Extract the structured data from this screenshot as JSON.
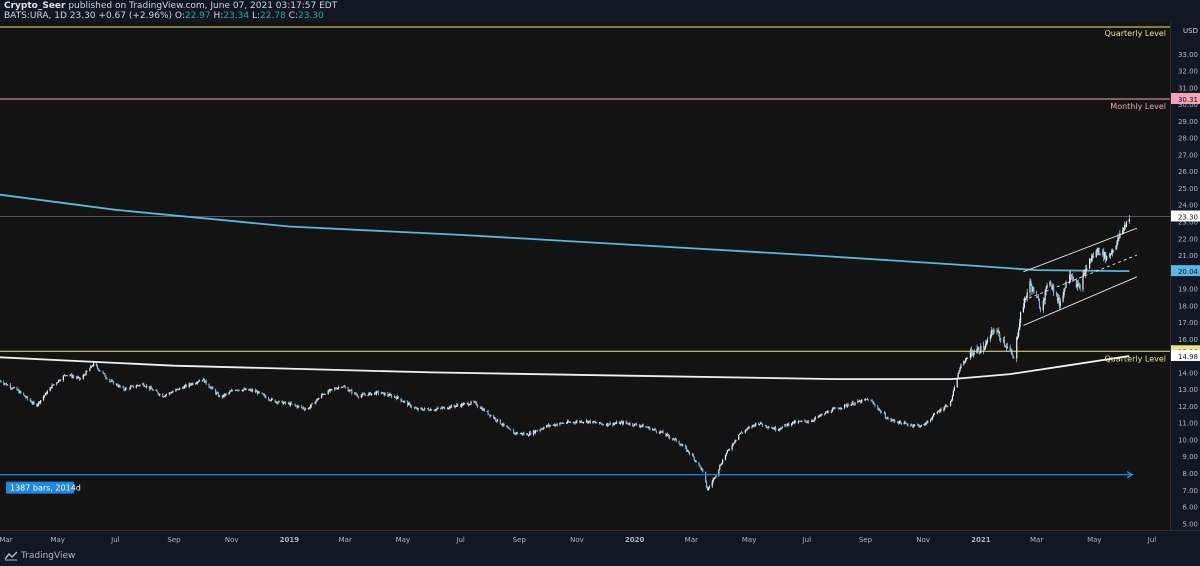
{
  "header": {
    "author": "Crypto_Seer",
    "published": "published on TradingView.com, June 07, 2021 03:17:57 EDT",
    "symbol": "BATS:URA, 1D",
    "last": "23.30",
    "change": "+0.67 (+2.96%)",
    "o_label": "O:",
    "o_value": "22.97",
    "h_label": "H:",
    "h_value": "23.34",
    "l_label": "L:",
    "l_value": "22.78",
    "c_label": "C:",
    "c_value": "23.30"
  },
  "footer": {
    "brand": "TradingView"
  },
  "colors": {
    "background": "#131313",
    "candle": "#e8f4fb",
    "ma_blue": "#5bb6e0",
    "ma_white": "#f0f0f0",
    "quarterly_level": "#e8e58a",
    "monthly_level": "#f2a6b8",
    "measure": "#2196f3"
  },
  "chart_data": {
    "type": "candlestick",
    "currency": "USD",
    "ylim": [
      4.6,
      34.9
    ],
    "y_ticks": [
      5,
      6,
      7,
      8,
      9,
      10,
      11,
      12,
      13,
      14,
      15,
      16,
      17,
      18,
      19,
      20,
      21,
      22,
      23,
      24,
      25,
      26,
      27,
      28,
      29,
      30,
      31,
      32,
      33
    ],
    "x_labels": [
      "Mar",
      "May",
      "Jul",
      "Sep",
      "Nov",
      "2019",
      "Mar",
      "May",
      "Jul",
      "Sep",
      "Nov",
      "2020",
      "Mar",
      "May",
      "Jul",
      "Sep",
      "Nov",
      "2021",
      "Mar",
      "May",
      "Jul"
    ],
    "x_start": "2018-03-01",
    "x_end": "2021-07-20",
    "close_path": [
      [
        "2018-03-01",
        13.5
      ],
      [
        "2018-03-20",
        12.9
      ],
      [
        "2018-04-08",
        12.0
      ],
      [
        "2018-04-25",
        13.2
      ],
      [
        "2018-05-10",
        13.9
      ],
      [
        "2018-05-25",
        13.6
      ],
      [
        "2018-06-08",
        14.5
      ],
      [
        "2018-06-25",
        13.5
      ],
      [
        "2018-07-10",
        13.0
      ],
      [
        "2018-07-30",
        13.3
      ],
      [
        "2018-08-20",
        12.6
      ],
      [
        "2018-09-10",
        13.1
      ],
      [
        "2018-10-01",
        13.6
      ],
      [
        "2018-10-20",
        12.5
      ],
      [
        "2018-11-05",
        13.0
      ],
      [
        "2018-11-25",
        12.9
      ],
      [
        "2018-12-15",
        12.3
      ],
      [
        "2019-01-02",
        12.1
      ],
      [
        "2019-01-20",
        11.8
      ],
      [
        "2019-02-05",
        12.7
      ],
      [
        "2019-02-25",
        13.2
      ],
      [
        "2019-03-15",
        12.6
      ],
      [
        "2019-04-05",
        12.8
      ],
      [
        "2019-04-25",
        12.5
      ],
      [
        "2019-05-15",
        11.8
      ],
      [
        "2019-06-05",
        11.8
      ],
      [
        "2019-06-25",
        12.0
      ],
      [
        "2019-07-15",
        12.2
      ],
      [
        "2019-08-05",
        11.3
      ],
      [
        "2019-08-25",
        10.4
      ],
      [
        "2019-09-10",
        10.3
      ],
      [
        "2019-09-30",
        10.8
      ],
      [
        "2019-10-20",
        11.0
      ],
      [
        "2019-11-10",
        11.1
      ],
      [
        "2019-11-30",
        10.9
      ],
      [
        "2019-12-20",
        11.0
      ],
      [
        "2020-01-10",
        10.8
      ],
      [
        "2020-01-30",
        10.4
      ],
      [
        "2020-02-15",
        9.9
      ],
      [
        "2020-03-01",
        9.1
      ],
      [
        "2020-03-12",
        8.2
      ],
      [
        "2020-03-18",
        7.0
      ],
      [
        "2020-03-25",
        7.7
      ],
      [
        "2020-04-05",
        9.0
      ],
      [
        "2020-04-20",
        10.3
      ],
      [
        "2020-05-10",
        11.0
      ],
      [
        "2020-05-30",
        10.6
      ],
      [
        "2020-06-15",
        11.0
      ],
      [
        "2020-07-05",
        11.1
      ],
      [
        "2020-07-25",
        11.7
      ],
      [
        "2020-08-15",
        12.1
      ],
      [
        "2020-09-05",
        12.4
      ],
      [
        "2020-09-25",
        11.2
      ],
      [
        "2020-10-15",
        10.9
      ],
      [
        "2020-11-01",
        10.8
      ],
      [
        "2020-11-15",
        11.6
      ],
      [
        "2020-11-30",
        12.2
      ],
      [
        "2020-12-10",
        14.3
      ],
      [
        "2020-12-20",
        15.1
      ],
      [
        "2021-01-05",
        15.5
      ],
      [
        "2021-01-15",
        16.6
      ],
      [
        "2021-01-25",
        15.9
      ],
      [
        "2021-02-05",
        14.8
      ],
      [
        "2021-02-12",
        17.5
      ],
      [
        "2021-02-22",
        19.3
      ],
      [
        "2021-03-05",
        17.9
      ],
      [
        "2021-03-15",
        19.5
      ],
      [
        "2021-03-25",
        18.1
      ],
      [
        "2021-04-05",
        20.0
      ],
      [
        "2021-04-15",
        19.0
      ],
      [
        "2021-04-25",
        20.6
      ],
      [
        "2021-05-05",
        21.3
      ],
      [
        "2021-05-15",
        20.8
      ],
      [
        "2021-05-25",
        21.8
      ],
      [
        "2021-06-07",
        23.3
      ]
    ],
    "series": [
      {
        "kind": "ma",
        "color": "#5bb6e0",
        "points": [
          [
            "2018-03-01",
            24.6
          ],
          [
            "2018-07-01",
            23.7
          ],
          [
            "2019-01-01",
            22.7
          ],
          [
            "2019-07-01",
            22.2
          ],
          [
            "2020-01-01",
            21.6
          ],
          [
            "2020-07-01",
            21.0
          ],
          [
            "2020-12-15",
            20.4
          ],
          [
            "2021-03-01",
            20.1
          ],
          [
            "2021-06-07",
            20.04
          ]
        ]
      },
      {
        "kind": "ma",
        "color": "#f0f0f0",
        "points": [
          [
            "2018-03-01",
            14.9
          ],
          [
            "2018-09-01",
            14.4
          ],
          [
            "2019-06-01",
            14.0
          ],
          [
            "2020-01-01",
            13.8
          ],
          [
            "2020-08-01",
            13.6
          ],
          [
            "2020-12-01",
            13.6
          ],
          [
            "2021-02-01",
            13.9
          ],
          [
            "2021-04-01",
            14.4
          ],
          [
            "2021-06-07",
            14.98
          ]
        ]
      }
    ],
    "levels": [
      {
        "label": "Quarterly Level",
        "value": 34.6,
        "color": "#e8e58a"
      },
      {
        "label": "Monthly Level",
        "value": 30.31,
        "color": "#f2a6b8"
      },
      {
        "label": "Quarterly Level",
        "value": 15.26,
        "color": "#e8e58a"
      }
    ],
    "current_price_line": 23.3,
    "channel": [
      [
        [
          "2021-02-15",
          20.0
        ],
        [
          "2021-06-15",
          22.6
        ]
      ],
      [
        [
          "2021-02-15",
          18.3
        ],
        [
          "2021-06-15",
          21.0
        ]
      ],
      [
        [
          "2021-02-15",
          16.8
        ],
        [
          "2021-06-15",
          19.7
        ]
      ]
    ],
    "measure": {
      "label": "1387 bars, 2014d",
      "value": 7.9,
      "from": "2018-03-01",
      "to": "2021-06-10"
    },
    "price_labels": [
      {
        "text": "USD",
        "value": null,
        "bg": null,
        "fg": "#d1d4dc"
      },
      {
        "text": "30.31",
        "value": 30.31,
        "bg": "#f2a6b8",
        "fg": "#131722"
      },
      {
        "text": "23.30",
        "value": 23.3,
        "bg": "#ffffff",
        "fg": "#131722"
      },
      {
        "text": "20.04",
        "value": 20.04,
        "bg": "#5bb6e0",
        "fg": "#131722"
      },
      {
        "text": "15.26",
        "value": 15.26,
        "bg": "#e8e58a",
        "fg": "#131722"
      },
      {
        "text": "14.98",
        "value": 14.98,
        "bg": "#ffffff",
        "fg": "#131722"
      }
    ]
  }
}
